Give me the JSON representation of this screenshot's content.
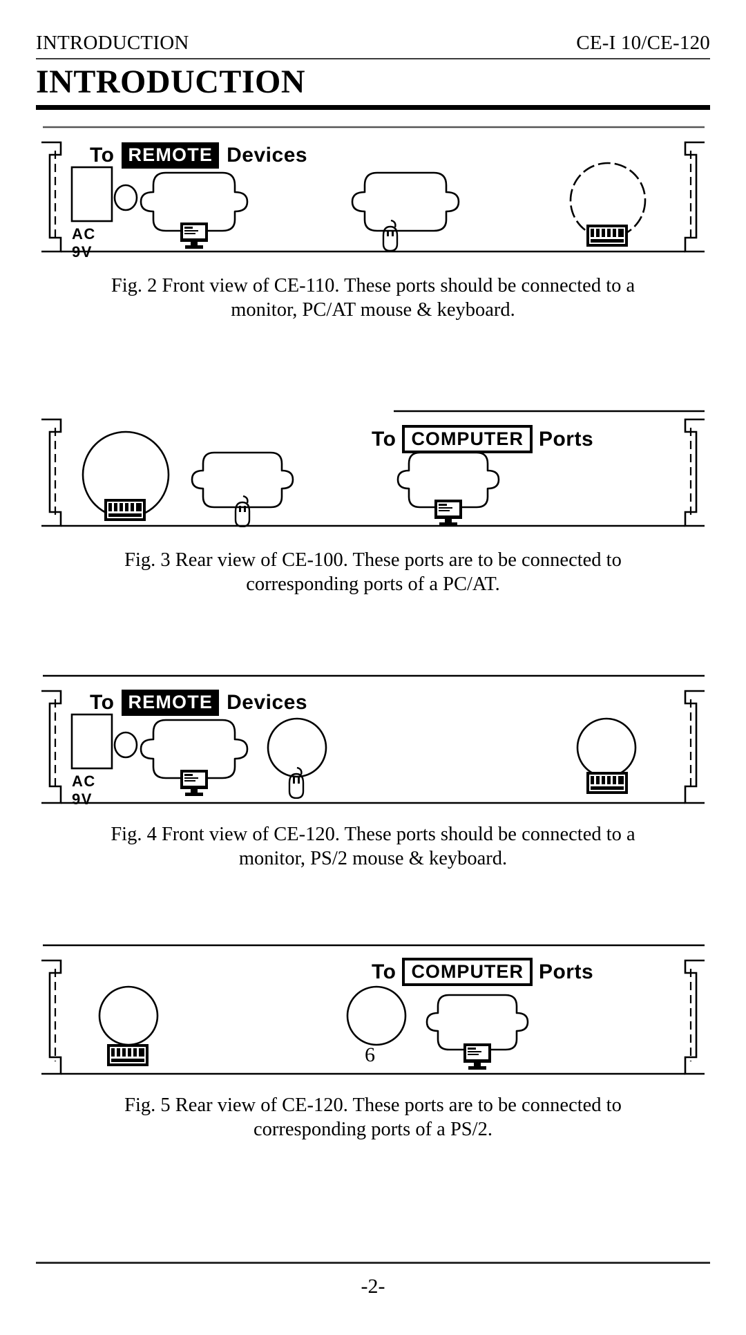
{
  "header": {
    "left_title": "INTRODUCTION",
    "right_title": "CE-I 10/CE-120"
  },
  "chapter_title": "INTRODUCTION",
  "footer": {
    "page_label": "-2-"
  },
  "stray_page_number": "6",
  "panel_labels": {
    "to": "To",
    "remote": "REMOTE",
    "devices": "Devices",
    "computer": "COMPUTER",
    "ports": "Ports",
    "ac_9v": "AC 9V"
  },
  "figures": [
    {
      "id": "fig2",
      "panel_kind": "front-remote",
      "banner": {
        "prefix": "To",
        "boxed": "REMOTE",
        "suffix": "Devices",
        "box_style": "inverse"
      },
      "power_label": "AC 9V",
      "icons": [
        "monitor-icon",
        "mouse-icon",
        "keyboard-icon"
      ],
      "caption_line1": "Fig. 2 Front view of CE-110. These ports should be connected to a",
      "caption_line2": "monitor, PC/AT  mouse  &  keyboard."
    },
    {
      "id": "fig3",
      "panel_kind": "rear-computer",
      "banner": {
        "prefix": "To",
        "boxed": "COMPUTER",
        "suffix": "Ports",
        "box_style": "outline"
      },
      "power_label": "",
      "icons": [
        "keyboard-icon",
        "mouse-icon",
        "monitor-icon"
      ],
      "caption_line1": "Fig. 3 Rear  view  of  CE-100.  These  ports  are  to  be  connected  to",
      "caption_line2": "corresponding ports of a PC/AT."
    },
    {
      "id": "fig4",
      "panel_kind": "front-remote-ps2",
      "banner": {
        "prefix": "To",
        "boxed": "REMOTE",
        "suffix": "Devices",
        "box_style": "inverse"
      },
      "power_label": "AC 9V",
      "icons": [
        "monitor-icon",
        "mouse-icon",
        "keyboard-icon"
      ],
      "caption_line1": "Fig. 4 Front  view  of  CE-120.  These  ports  should  be  connected  to  a",
      "caption_line2": "monitor, PS/2 mouse &  keyboard."
    },
    {
      "id": "fig5",
      "panel_kind": "rear-computer-ps2",
      "banner": {
        "prefix": "To",
        "boxed": "COMPUTER",
        "suffix": "Ports",
        "box_style": "outline"
      },
      "power_label": "",
      "icons": [
        "keyboard-icon",
        "monitor-icon"
      ],
      "caption_line1": "Fig. 5 Rear  view  of  CE-120.  These  ports  are  to  be  connected  to",
      "caption_line2": "corresponding ports of a PS/2."
    }
  ]
}
